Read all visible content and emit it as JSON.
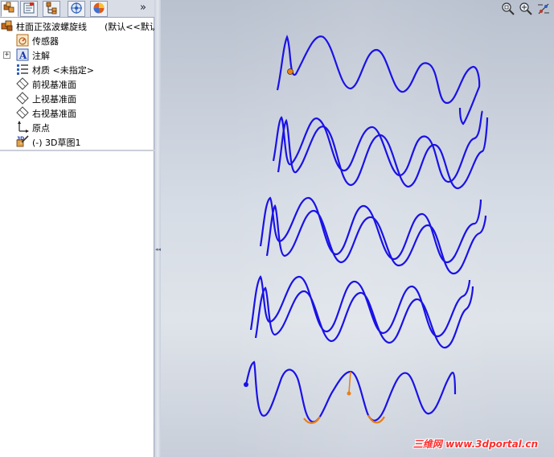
{
  "feature_tree": {
    "tabs": [
      {
        "name": "feature-manager",
        "icon": "feature-tree-icon"
      },
      {
        "name": "property-manager",
        "icon": "property-manager-icon"
      },
      {
        "name": "configuration-manager",
        "icon": "configuration-icon"
      },
      {
        "name": "dimxpert-manager",
        "icon": "dimxpert-icon"
      },
      {
        "name": "display-manager",
        "icon": "appearance-icon"
      }
    ],
    "more_tabs_label": "»",
    "part_name": "柱面正弦波螺旋线",
    "part_config": "(默认<<默认",
    "items": [
      {
        "label": "传感器",
        "icon": "sensor-icon",
        "expandable": false
      },
      {
        "label": "注解",
        "icon": "annotation-icon",
        "expandable": true,
        "expander": "+"
      },
      {
        "label": "材质 <未指定>",
        "icon": "material-icon",
        "expandable": false
      },
      {
        "label": "前视基准面",
        "icon": "plane-icon",
        "expandable": false
      },
      {
        "label": "上视基准面",
        "icon": "plane-icon",
        "expandable": false
      },
      {
        "label": "右视基准面",
        "icon": "plane-icon",
        "expandable": false
      },
      {
        "label": "原点",
        "icon": "origin-icon",
        "expandable": false
      },
      {
        "label": "(-) 3D草图1",
        "icon": "sketch3d-icon",
        "expandable": false
      }
    ]
  },
  "splitter": {
    "grip": "◂◂◂"
  },
  "viewport": {
    "tools": [
      "zoom-to-fit-icon",
      "zoom-to-area-icon",
      "view-orientation-icon"
    ],
    "curve_color": "#1a12e6",
    "highlight_color": "#e8801a",
    "background_top": "#b9c1cf",
    "background_mid": "#dfe4ea"
  },
  "watermark": {
    "text_cn": "三维网",
    "text_url": "www.3dportal.cn",
    "color": "#ff2d2d"
  }
}
